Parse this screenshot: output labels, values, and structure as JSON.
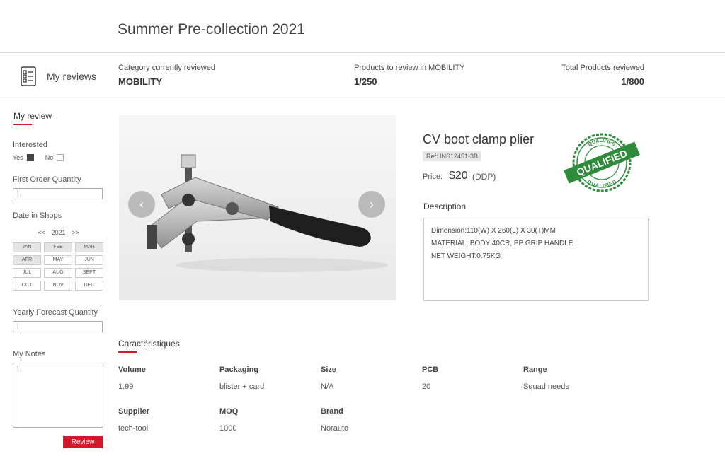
{
  "page": {
    "title": "Summer Pre-collection 2021"
  },
  "header": {
    "my_reviews_label": "My reviews",
    "stats": {
      "category_label": "Category currently reviewed",
      "category_value": "MOBILITY",
      "to_review_label": "Products to review in MOBILITY",
      "to_review_value": "1/250",
      "total_label": "Total Products reviewed",
      "total_value": "1/800"
    }
  },
  "sidebar": {
    "title": "My review",
    "interested_label": "Interested",
    "yes_label": "Yes",
    "no_label": "No",
    "interested_value": "Yes",
    "first_order_label": "First Order Quantity",
    "first_order_value": "|",
    "date_label": "Date in Shops",
    "year_prev": "<<",
    "year": "2021",
    "year_next": ">>",
    "months": [
      "JAN",
      "FEB",
      "MAR",
      "APR",
      "MAY",
      "JUN",
      "JUL",
      "AUG",
      "SEPT",
      "OCT",
      "NOV",
      "DEC"
    ],
    "selected_months": [
      "JAN",
      "FEB",
      "MAR",
      "APR"
    ],
    "forecast_label": "Yearly Forecast Quantity",
    "forecast_value": "|",
    "notes_label": "My Notes",
    "notes_value": "|",
    "review_button": "Review"
  },
  "product": {
    "title": "CV boot clamp plier",
    "ref": "Ref: INS12451-3B",
    "price_label": "Price:",
    "price_value": "$20",
    "price_terms": "(DDP)",
    "seal_text": "QUALIFIED",
    "seal_arc_top": "QUALIFIED",
    "seal_arc_bottom": "QUALIFIED",
    "description_title": "Description",
    "description_lines": [
      "Dimension:110(W) X 260(L) X 30(T)MM",
      "MATERIAL: BODY 40CR, PP GRIP HANDLE",
      "NET WEIGHT:0.75KG"
    ],
    "prev_arrow": "‹",
    "next_arrow": "›"
  },
  "characteristics": {
    "title": "Caractéristiques",
    "items": [
      {
        "label": "Volume",
        "value": "1.99"
      },
      {
        "label": "Packaging",
        "value": "blister + card"
      },
      {
        "label": "Size",
        "value": "N/A"
      },
      {
        "label": "PCB",
        "value": "20"
      },
      {
        "label": "Range",
        "value": "Squad needs"
      },
      {
        "label": "Supplier",
        "value": "tech-tool"
      },
      {
        "label": "MOQ",
        "value": "1000"
      },
      {
        "label": "Brand",
        "value": "Norauto"
      }
    ]
  },
  "colors": {
    "accent": "#d5172a",
    "seal": "#2e8b3a"
  }
}
